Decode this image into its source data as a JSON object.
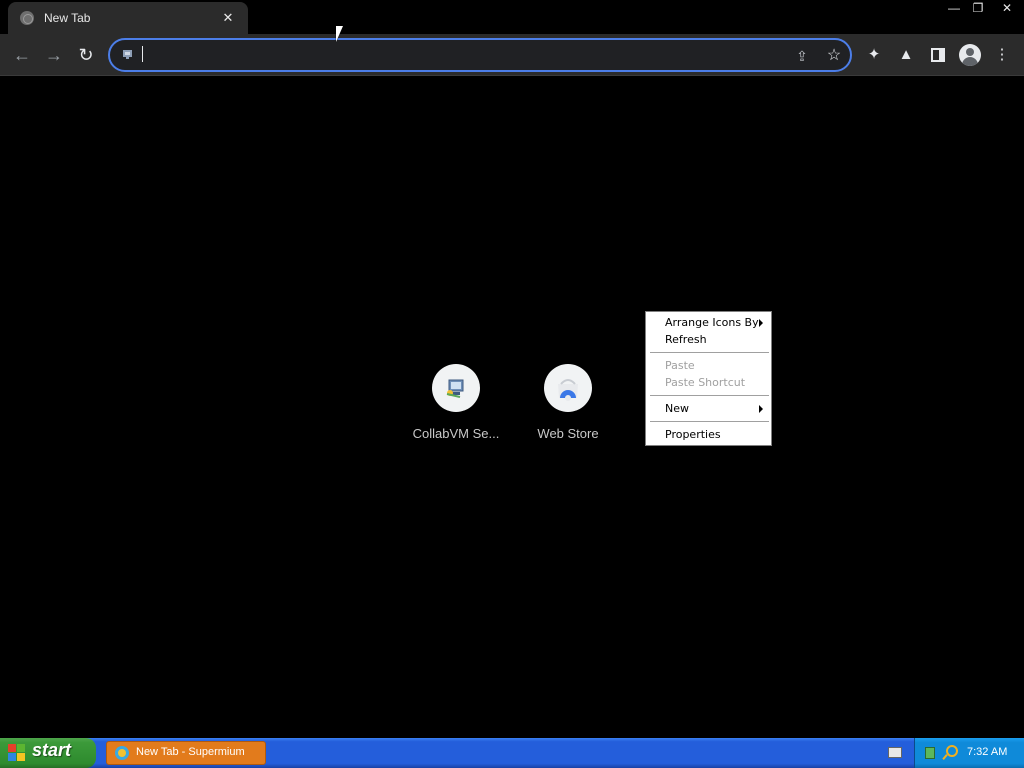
{
  "browser": {
    "tab": {
      "title": "New Tab",
      "close_glyph": "✕",
      "favicon": "globe-icon"
    },
    "window_controls": {
      "minimize": "—",
      "restore": "❐",
      "close": "✕"
    },
    "toolbar": {
      "back": "←",
      "forward": "→",
      "reload": "↻",
      "omnibox": {
        "value": "",
        "placeholder": "",
        "site_icon": "collabvm-icon"
      },
      "share": "⇪",
      "bookmark": "☆",
      "extensions": "✦",
      "labs": "▲",
      "more": "⋮"
    },
    "accent_color": "#4c7ee8"
  },
  "shortcuts": [
    {
      "label": "CollabVM Se...",
      "icon": "collabvm-icon"
    },
    {
      "label": "Web Store",
      "icon": "web-store-icon"
    }
  ],
  "context_menu": {
    "items": [
      {
        "label": "Arrange Icons By",
        "submenu": true,
        "disabled": false
      },
      {
        "label": "Refresh",
        "submenu": false,
        "disabled": false
      },
      {
        "label": "Paste",
        "submenu": false,
        "disabled": true
      },
      {
        "label": "Paste Shortcut",
        "submenu": false,
        "disabled": true
      },
      {
        "label": "New",
        "submenu": true,
        "disabled": false
      },
      {
        "label": "Properties",
        "submenu": false,
        "disabled": false
      }
    ]
  },
  "taskbar": {
    "start_label": "start",
    "task_label": "New Tab - Supermium",
    "clock": "7:32 AM"
  }
}
